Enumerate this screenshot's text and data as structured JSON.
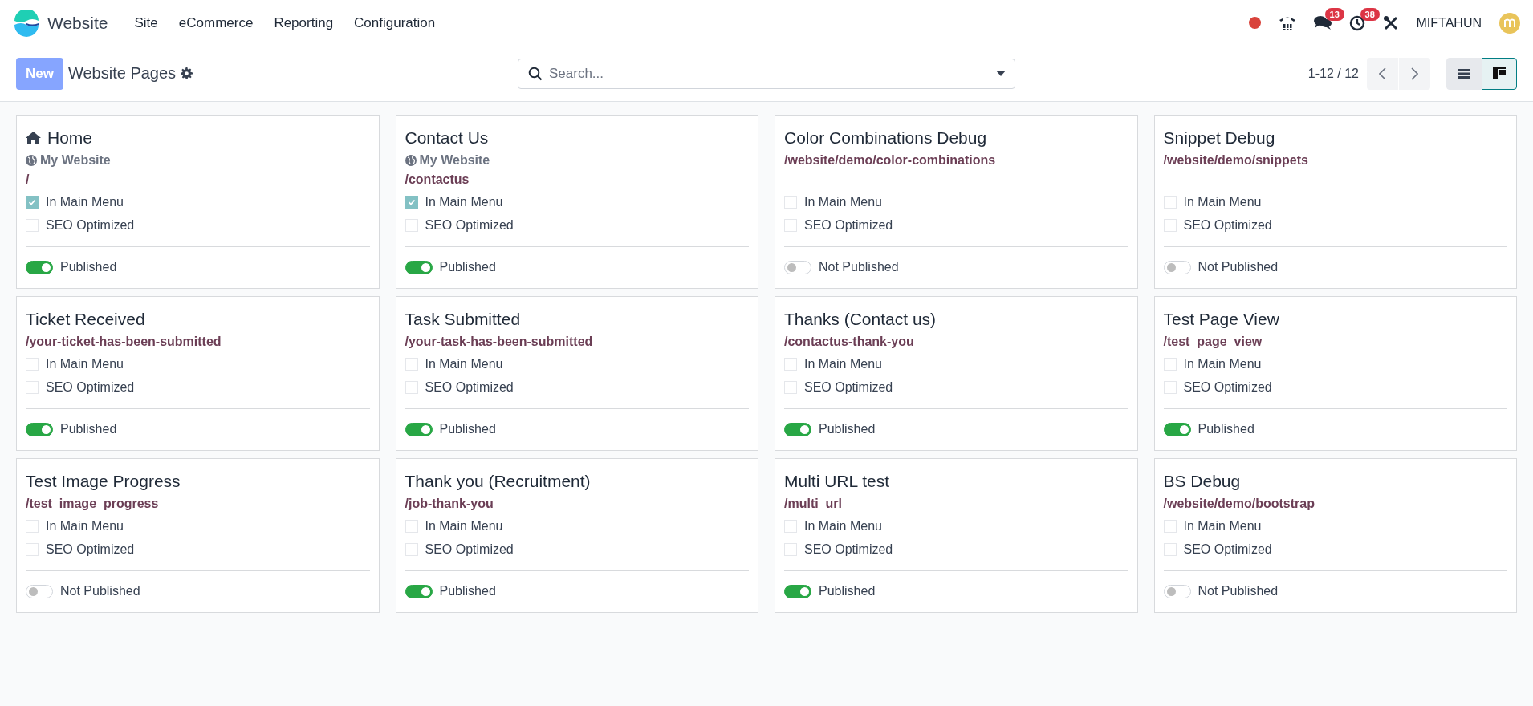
{
  "navbar": {
    "app_name": "Website",
    "menu": [
      "Site",
      "eCommerce",
      "Reporting",
      "Configuration"
    ],
    "messages_count": "13",
    "activities_count": "38",
    "user": "MIFTAHUN"
  },
  "control_panel": {
    "new_button": "New",
    "title": "Website Pages",
    "search": {
      "placeholder": "Search..."
    },
    "pager": "1-12 / 12",
    "views": [
      {
        "kind": "list",
        "selected": false
      },
      {
        "kind": "kanban",
        "selected": true
      }
    ]
  },
  "pages": [
    {
      "title": "Home",
      "homepage": true,
      "website": "My Website",
      "url": "/",
      "in_main_menu": true,
      "seo_optimized": false,
      "published": true,
      "status": "Published",
      "checkbox_labels": [
        "In Main Menu",
        "SEO Optimized"
      ]
    },
    {
      "title": "Contact Us",
      "homepage": false,
      "website": "My Website",
      "url": "/contactus",
      "in_main_menu": true,
      "seo_optimized": false,
      "published": true,
      "status": "Published",
      "checkbox_labels": [
        "In Main Menu",
        "SEO Optimized"
      ]
    },
    {
      "title": "Color Combinations Debug",
      "homepage": false,
      "url": "/website/demo/color-combinations",
      "in_main_menu": false,
      "seo_optimized": false,
      "published": false,
      "status": "Not Published",
      "checkbox_labels": [
        "In Main Menu",
        "SEO Optimized"
      ]
    },
    {
      "title": "Snippet Debug",
      "homepage": false,
      "url": "/website/demo/snippets",
      "in_main_menu": false,
      "seo_optimized": false,
      "published": false,
      "status": "Not Published",
      "checkbox_labels": [
        "In Main Menu",
        "SEO Optimized"
      ]
    },
    {
      "title": "Ticket Received",
      "homepage": false,
      "url": "/your-ticket-has-been-submitted",
      "in_main_menu": false,
      "seo_optimized": false,
      "published": true,
      "status": "Published",
      "checkbox_labels": [
        "In Main Menu",
        "SEO Optimized"
      ]
    },
    {
      "title": "Task Submitted",
      "homepage": false,
      "url": "/your-task-has-been-submitted",
      "in_main_menu": false,
      "seo_optimized": false,
      "published": true,
      "status": "Published",
      "checkbox_labels": [
        "In Main Menu",
        "SEO Optimized"
      ]
    },
    {
      "title": "Thanks (Contact us)",
      "homepage": false,
      "url": "/contactus-thank-you",
      "in_main_menu": false,
      "seo_optimized": false,
      "published": true,
      "status": "Published",
      "checkbox_labels": [
        "In Main Menu",
        "SEO Optimized"
      ]
    },
    {
      "title": "Test Page View",
      "homepage": false,
      "url": "/test_page_view",
      "in_main_menu": false,
      "seo_optimized": false,
      "published": true,
      "status": "Published",
      "checkbox_labels": [
        "In Main Menu",
        "SEO Optimized"
      ]
    },
    {
      "title": "Test Image Progress",
      "homepage": false,
      "url": "/test_image_progress",
      "in_main_menu": false,
      "seo_optimized": false,
      "published": false,
      "status": "Not Published",
      "checkbox_labels": [
        "In Main Menu",
        "SEO Optimized"
      ]
    },
    {
      "title": "Thank you (Recruitment)",
      "homepage": false,
      "url": "/job-thank-you",
      "in_main_menu": false,
      "seo_optimized": false,
      "published": true,
      "status": "Published",
      "checkbox_labels": [
        "In Main Menu",
        "SEO Optimized"
      ]
    },
    {
      "title": "Multi URL test",
      "homepage": false,
      "url": "/multi_url",
      "in_main_menu": false,
      "seo_optimized": false,
      "published": true,
      "status": "Published",
      "checkbox_labels": [
        "In Main Menu",
        "SEO Optimized"
      ]
    },
    {
      "title": "BS Debug",
      "homepage": false,
      "url": "/website/demo/bootstrap",
      "in_main_menu": false,
      "seo_optimized": false,
      "published": false,
      "status": "Not Published",
      "checkbox_labels": [
        "In Main Menu",
        "SEO Optimized"
      ]
    }
  ]
}
